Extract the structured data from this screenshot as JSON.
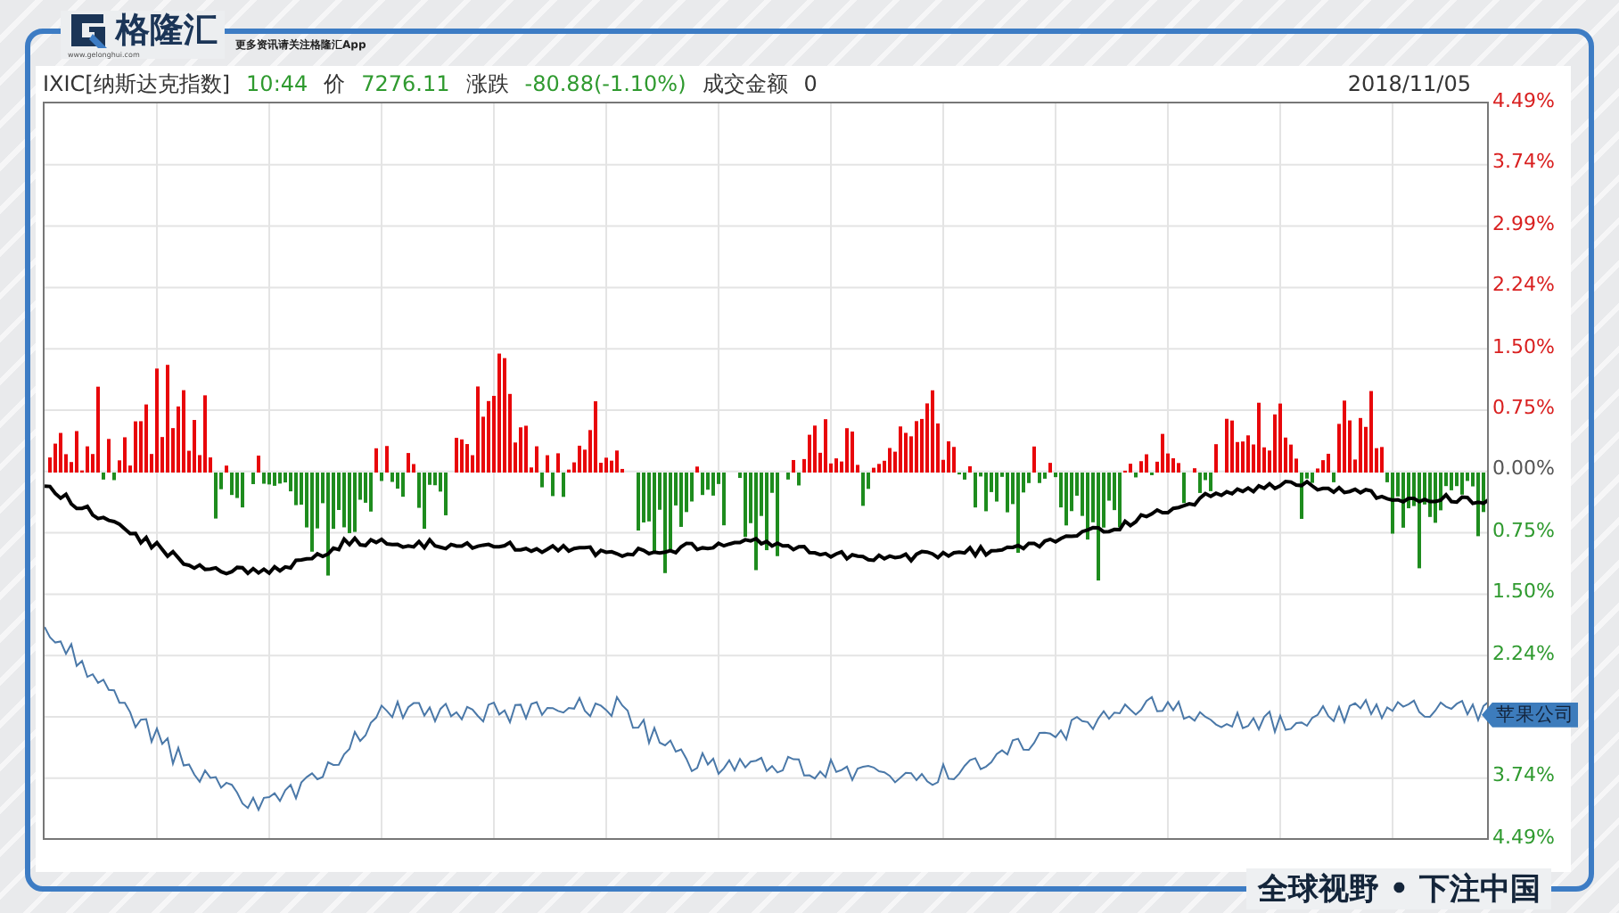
{
  "brand": {
    "name": "格隆汇",
    "site": "www.gelonghui.com",
    "tagline": "更多资讯请关注格隆汇App"
  },
  "header": {
    "fields": [
      {
        "text": "IXIC[纳斯达克指数]",
        "kind": "plain"
      },
      {
        "text": "10:44",
        "kind": "down"
      },
      {
        "text": "价",
        "kind": "plain"
      },
      {
        "text": "7276.11",
        "kind": "down"
      },
      {
        "text": "涨跌",
        "kind": "plain"
      },
      {
        "text": "-80.88(-1.10%)",
        "kind": "down"
      },
      {
        "text": "成交金额",
        "kind": "plain"
      },
      {
        "text": "0",
        "kind": "plain"
      }
    ],
    "date": "2018/11/05"
  },
  "axis": [
    {
      "text": "4.49%",
      "kind": "up"
    },
    {
      "text": "3.74%",
      "kind": "up"
    },
    {
      "text": "2.99%",
      "kind": "up"
    },
    {
      "text": "2.24%",
      "kind": "up"
    },
    {
      "text": "1.50%",
      "kind": "up"
    },
    {
      "text": "0.75%",
      "kind": "up"
    },
    {
      "text": "0.00%",
      "kind": "flat"
    },
    {
      "text": "0.75%",
      "kind": "down"
    },
    {
      "text": "1.50%",
      "kind": "down"
    },
    {
      "text": "2.24%",
      "kind": "down"
    },
    {
      "text": "苹果公司",
      "kind": "tag"
    },
    {
      "text": "3.74%",
      "kind": "down"
    },
    {
      "text": "4.49%",
      "kind": "down"
    }
  ],
  "banner": "全球视野 • 下注中国"
}
